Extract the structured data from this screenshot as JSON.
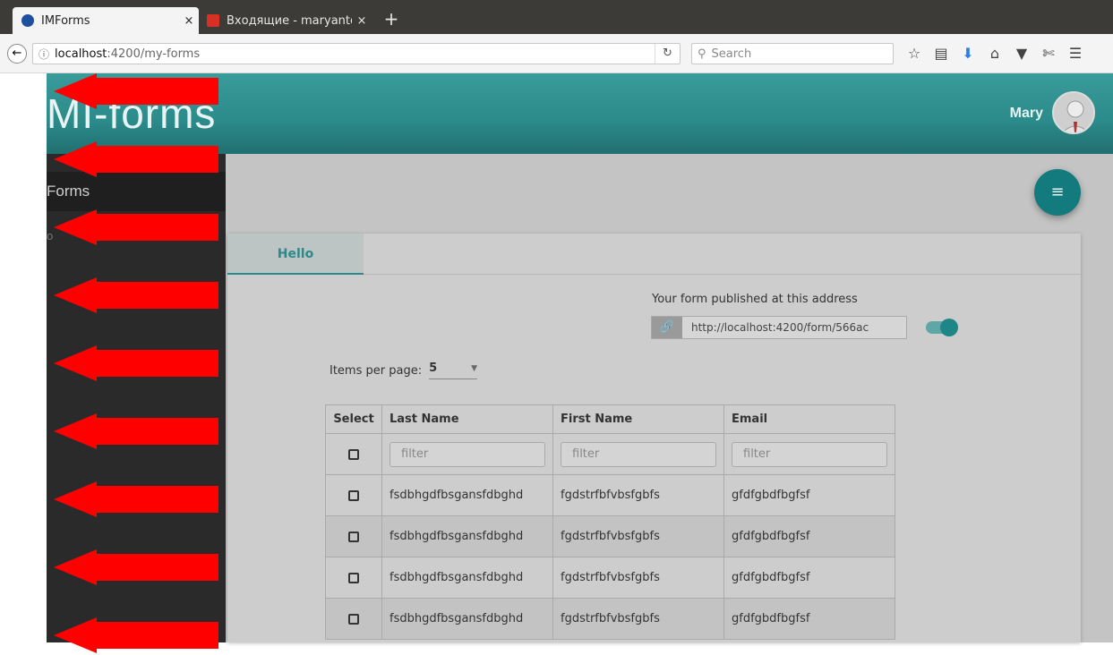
{
  "browser": {
    "tabs": [
      {
        "label": "IMForms",
        "active": true,
        "icon": "globe-icon",
        "icon_color": "#1f4f9f"
      },
      {
        "label": "Входящие - maryanto",
        "active": false,
        "icon": "gmail-icon",
        "icon_color": "#d93025"
      }
    ],
    "close_glyph": "×",
    "new_tab_glyph": "+",
    "url_host": "localhost",
    "url_path": ":4200/my-forms",
    "search_placeholder": "Search"
  },
  "app": {
    "logo": "MI-forms",
    "user_name": "Mary",
    "accent_color": "#2b8a8a",
    "sidebar": [
      {
        "label": "Forms"
      },
      {
        "label": "o"
      }
    ]
  },
  "form_card": {
    "tab_label": "Hello",
    "published_label": "Your form published at this address",
    "published_url": "http://localhost:4200/form/566ac",
    "toggle_on": true,
    "items_per_page_label": "Items per page:",
    "items_per_page_value": "5",
    "columns": [
      "Select",
      "Last Name",
      "First Name",
      "Email"
    ],
    "filter_placeholder": "filter",
    "rows": [
      {
        "last": "fsdbhgdfbsgansfdbghd",
        "first": "fgdstrfbfvbsfgbfs",
        "email": "gfdfgbdfbgfsf"
      },
      {
        "last": "fsdbhgdfbsgansfdbghd",
        "first": "fgdstrfbfvbsfgbfs",
        "email": "gfdfgbdfbgfsf"
      },
      {
        "last": "fsdbhgdfbsgansfdbghd",
        "first": "fgdstrfbfvbsfgbfs",
        "email": "gfdfgbdfbgfsf"
      },
      {
        "last": "fsdbhgdfbsgansfdbghd",
        "first": "fgdstrfbfvbsfgbfs",
        "email": "gfdfgbdfbgfsf"
      }
    ]
  },
  "annotation": {
    "arrow_color": "#ff0000",
    "arrow_count": 9
  }
}
